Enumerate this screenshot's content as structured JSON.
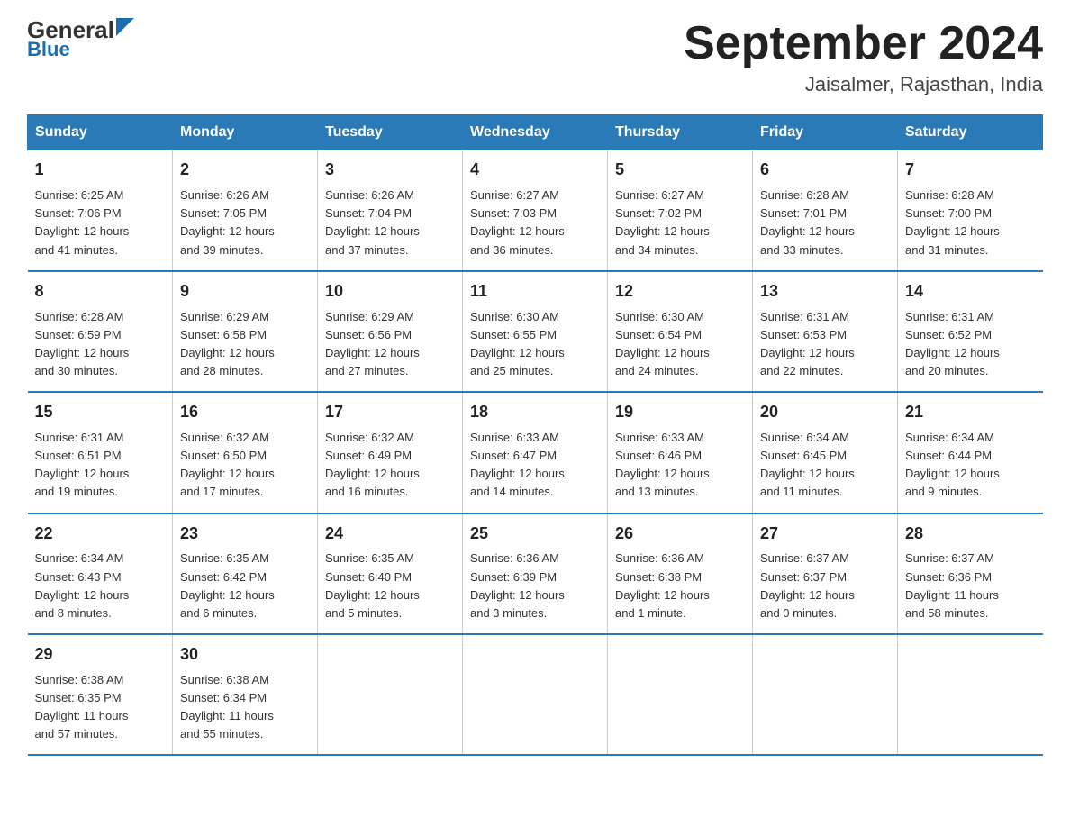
{
  "header": {
    "logo_text": "General",
    "logo_blue": "Blue",
    "month_title": "September 2024",
    "location": "Jaisalmer, Rajasthan, India"
  },
  "weekdays": [
    "Sunday",
    "Monday",
    "Tuesday",
    "Wednesday",
    "Thursday",
    "Friday",
    "Saturday"
  ],
  "weeks": [
    [
      {
        "day": "1",
        "info": "Sunrise: 6:25 AM\nSunset: 7:06 PM\nDaylight: 12 hours\nand 41 minutes."
      },
      {
        "day": "2",
        "info": "Sunrise: 6:26 AM\nSunset: 7:05 PM\nDaylight: 12 hours\nand 39 minutes."
      },
      {
        "day": "3",
        "info": "Sunrise: 6:26 AM\nSunset: 7:04 PM\nDaylight: 12 hours\nand 37 minutes."
      },
      {
        "day": "4",
        "info": "Sunrise: 6:27 AM\nSunset: 7:03 PM\nDaylight: 12 hours\nand 36 minutes."
      },
      {
        "day": "5",
        "info": "Sunrise: 6:27 AM\nSunset: 7:02 PM\nDaylight: 12 hours\nand 34 minutes."
      },
      {
        "day": "6",
        "info": "Sunrise: 6:28 AM\nSunset: 7:01 PM\nDaylight: 12 hours\nand 33 minutes."
      },
      {
        "day": "7",
        "info": "Sunrise: 6:28 AM\nSunset: 7:00 PM\nDaylight: 12 hours\nand 31 minutes."
      }
    ],
    [
      {
        "day": "8",
        "info": "Sunrise: 6:28 AM\nSunset: 6:59 PM\nDaylight: 12 hours\nand 30 minutes."
      },
      {
        "day": "9",
        "info": "Sunrise: 6:29 AM\nSunset: 6:58 PM\nDaylight: 12 hours\nand 28 minutes."
      },
      {
        "day": "10",
        "info": "Sunrise: 6:29 AM\nSunset: 6:56 PM\nDaylight: 12 hours\nand 27 minutes."
      },
      {
        "day": "11",
        "info": "Sunrise: 6:30 AM\nSunset: 6:55 PM\nDaylight: 12 hours\nand 25 minutes."
      },
      {
        "day": "12",
        "info": "Sunrise: 6:30 AM\nSunset: 6:54 PM\nDaylight: 12 hours\nand 24 minutes."
      },
      {
        "day": "13",
        "info": "Sunrise: 6:31 AM\nSunset: 6:53 PM\nDaylight: 12 hours\nand 22 minutes."
      },
      {
        "day": "14",
        "info": "Sunrise: 6:31 AM\nSunset: 6:52 PM\nDaylight: 12 hours\nand 20 minutes."
      }
    ],
    [
      {
        "day": "15",
        "info": "Sunrise: 6:31 AM\nSunset: 6:51 PM\nDaylight: 12 hours\nand 19 minutes."
      },
      {
        "day": "16",
        "info": "Sunrise: 6:32 AM\nSunset: 6:50 PM\nDaylight: 12 hours\nand 17 minutes."
      },
      {
        "day": "17",
        "info": "Sunrise: 6:32 AM\nSunset: 6:49 PM\nDaylight: 12 hours\nand 16 minutes."
      },
      {
        "day": "18",
        "info": "Sunrise: 6:33 AM\nSunset: 6:47 PM\nDaylight: 12 hours\nand 14 minutes."
      },
      {
        "day": "19",
        "info": "Sunrise: 6:33 AM\nSunset: 6:46 PM\nDaylight: 12 hours\nand 13 minutes."
      },
      {
        "day": "20",
        "info": "Sunrise: 6:34 AM\nSunset: 6:45 PM\nDaylight: 12 hours\nand 11 minutes."
      },
      {
        "day": "21",
        "info": "Sunrise: 6:34 AM\nSunset: 6:44 PM\nDaylight: 12 hours\nand 9 minutes."
      }
    ],
    [
      {
        "day": "22",
        "info": "Sunrise: 6:34 AM\nSunset: 6:43 PM\nDaylight: 12 hours\nand 8 minutes."
      },
      {
        "day": "23",
        "info": "Sunrise: 6:35 AM\nSunset: 6:42 PM\nDaylight: 12 hours\nand 6 minutes."
      },
      {
        "day": "24",
        "info": "Sunrise: 6:35 AM\nSunset: 6:40 PM\nDaylight: 12 hours\nand 5 minutes."
      },
      {
        "day": "25",
        "info": "Sunrise: 6:36 AM\nSunset: 6:39 PM\nDaylight: 12 hours\nand 3 minutes."
      },
      {
        "day": "26",
        "info": "Sunrise: 6:36 AM\nSunset: 6:38 PM\nDaylight: 12 hours\nand 1 minute."
      },
      {
        "day": "27",
        "info": "Sunrise: 6:37 AM\nSunset: 6:37 PM\nDaylight: 12 hours\nand 0 minutes."
      },
      {
        "day": "28",
        "info": "Sunrise: 6:37 AM\nSunset: 6:36 PM\nDaylight: 11 hours\nand 58 minutes."
      }
    ],
    [
      {
        "day": "29",
        "info": "Sunrise: 6:38 AM\nSunset: 6:35 PM\nDaylight: 11 hours\nand 57 minutes."
      },
      {
        "day": "30",
        "info": "Sunrise: 6:38 AM\nSunset: 6:34 PM\nDaylight: 11 hours\nand 55 minutes."
      },
      {
        "day": "",
        "info": ""
      },
      {
        "day": "",
        "info": ""
      },
      {
        "day": "",
        "info": ""
      },
      {
        "day": "",
        "info": ""
      },
      {
        "day": "",
        "info": ""
      }
    ]
  ]
}
